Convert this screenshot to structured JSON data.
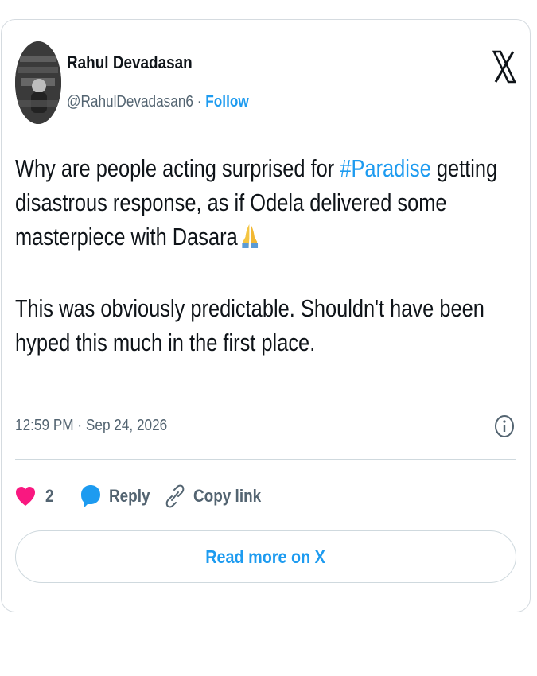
{
  "author": {
    "name": "Rahul Devadasan",
    "handle": "@RahulDevadasan6",
    "separator": " · ",
    "follow_label": "Follow"
  },
  "tweet": {
    "line1_before": "Why are people acting surprised for ",
    "hashtag": "#Paradise",
    "line1_after": " getting disastrous response, as if Odela delivered some masterpiece with Dasara",
    "emoji_icon": "folded-hands-icon",
    "paragraph2": "This was obviously predictable. Shouldn't have been hyped this much in the first place."
  },
  "timestamp": "12:59 PM · Sep 24, 2026",
  "actions": {
    "like_count": "2",
    "reply_label": "Reply",
    "copy_label": "Copy link"
  },
  "read_more_label": "Read more on X",
  "icons": {
    "logo": "x-logo-icon",
    "info": "info-icon",
    "like": "heart-icon",
    "reply": "speech-bubble-icon",
    "copy": "link-icon"
  },
  "colors": {
    "accent": "#1d9bf0",
    "text": "#0f1419",
    "muted": "#536471",
    "heart": "#f91880",
    "border": "#cfd9de"
  }
}
